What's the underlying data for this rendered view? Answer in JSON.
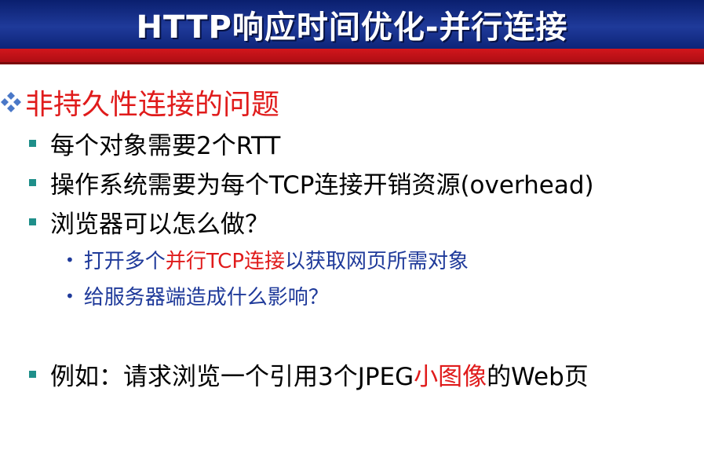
{
  "header": {
    "title": "HTTP响应时间优化-并行连接"
  },
  "section": {
    "heading": "非持久性连接的问题",
    "icon": "diamond-cluster-bullet-icon"
  },
  "bullets": [
    {
      "text": "每个对象需要2个RTT"
    },
    {
      "text": "操作系统需要为每个TCP连接开销资源(overhead)"
    },
    {
      "text": "浏览器可以怎么做？"
    }
  ],
  "sub_bullets": [
    {
      "pre": "打开多个",
      "highlight": "并行TCP连接",
      "post": "以获取网页所需对象"
    },
    {
      "text": "给服务器端造成什么影响？"
    }
  ],
  "example": {
    "pre": "例如：请求浏览一个引用3个JPEG",
    "highlight": "小图像",
    "post": "的Web页"
  },
  "colors": {
    "header_bg": "#1f3a9a",
    "stripe": "#d2161c",
    "heading": "#e01b1b",
    "sub_text": "#1f3a9a",
    "bullet_square": "#1f8f8a"
  }
}
